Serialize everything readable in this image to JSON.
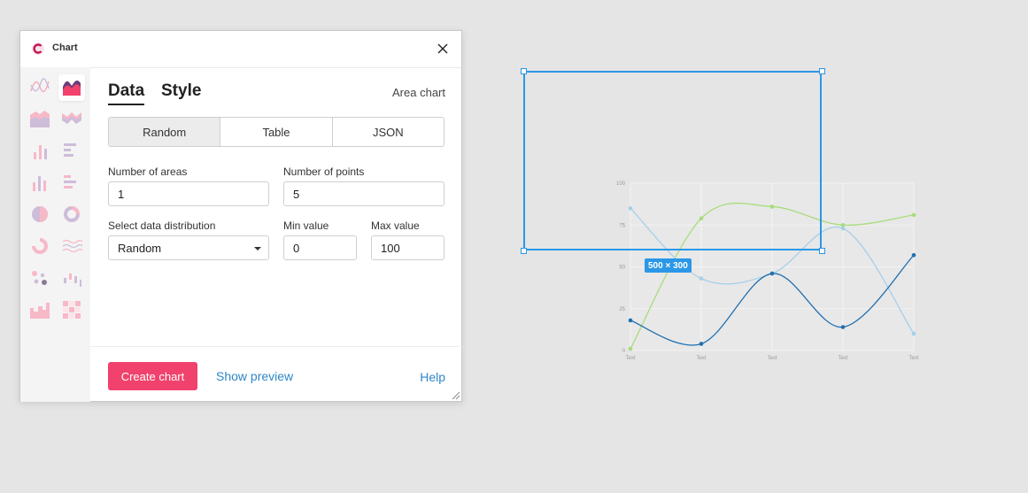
{
  "window": {
    "title": "Chart",
    "close_icon": "close-icon",
    "logo_icon": "chart-logo-icon"
  },
  "sidebar": {
    "items": [
      {
        "icon": "line-chart-icon"
      },
      {
        "icon": "area-chart-icon",
        "active": true
      },
      {
        "icon": "stacked-area-icon"
      },
      {
        "icon": "stream-area-icon"
      },
      {
        "icon": "bar-chart-icon"
      },
      {
        "icon": "horizontal-bar-icon"
      },
      {
        "icon": "grouped-bar-icon"
      },
      {
        "icon": "grouped-horizontal-bar-icon"
      },
      {
        "icon": "pie-chart-icon"
      },
      {
        "icon": "donut-chart-icon"
      },
      {
        "icon": "ring-chart-icon"
      },
      {
        "icon": "wave-line-icon"
      },
      {
        "icon": "scatter-icon"
      },
      {
        "icon": "waterfall-icon"
      },
      {
        "icon": "step-chart-icon"
      },
      {
        "icon": "heatmap-icon"
      }
    ]
  },
  "tabs": {
    "data": "Data",
    "style": "Style",
    "chart_type": "Area chart"
  },
  "source": {
    "options": [
      "Random",
      "Table",
      "JSON"
    ],
    "selected": "Random"
  },
  "form": {
    "areas_label": "Number of areas",
    "areas_value": "1",
    "points_label": "Number of points",
    "points_value": "5",
    "dist_label": "Select data distribution",
    "dist_value": "Random",
    "min_label": "Min value",
    "min_value": "0",
    "max_label": "Max value",
    "max_value": "100"
  },
  "footer": {
    "create": "Create chart",
    "preview": "Show preview",
    "help": "Help"
  },
  "canvas": {
    "size_badge": "500 × 300"
  },
  "chart_data": {
    "type": "line",
    "categories": [
      "Text",
      "Text",
      "Text",
      "Text",
      "Text"
    ],
    "ylim": [
      0,
      100
    ],
    "yticks": [
      0,
      25,
      50,
      75,
      100
    ],
    "series": [
      {
        "color": "#a8dc7c",
        "values": [
          1,
          79,
          86,
          75,
          81
        ]
      },
      {
        "color": "#a6cfe9",
        "values": [
          85,
          43,
          46,
          73,
          10
        ]
      },
      {
        "color": "#2170b0",
        "values": [
          18,
          4,
          46,
          14,
          57
        ]
      }
    ]
  }
}
